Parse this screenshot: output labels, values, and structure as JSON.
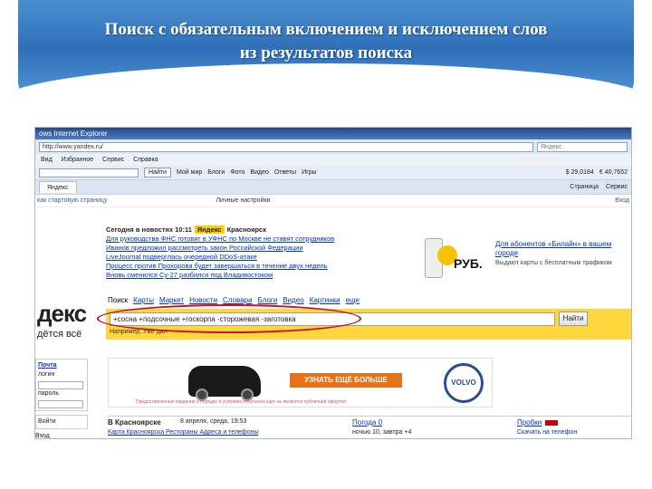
{
  "slide": {
    "title_line1": "Поиск с обязательным включением и исключением слов",
    "title_line2": "из результатов поиска"
  },
  "browser": {
    "title": "ows Internet Explorer",
    "address": "http://www.yandex.ru/",
    "search_placeholder": "Яндекс",
    "menu": [
      "Вид",
      "Избранное",
      "Сервис",
      "Справка"
    ],
    "toolbar": [
      "Найти",
      "Мой мир",
      "Блоги",
      "Фото",
      "Видео",
      "Ответы",
      "Игры"
    ],
    "toolbar_right": [
      "$ 29,0184",
      "€ 40,7652"
    ],
    "tab_label": "Яндекс",
    "tab_right": [
      "Страница",
      "Сервис"
    ]
  },
  "page": {
    "top_left": "как стартовую страницу",
    "top_mid": "Личные настройки",
    "top_right": "Вход",
    "news_header": "Сегодня в новостях 10:11",
    "news_badge": "Яндекс",
    "news_city": "Красноярск",
    "news": [
      "Для руководства ФНС готовят в УФНС по Москве не ставят сотрудников",
      "Иванов предложил рассмотреть закон Российской Федерации",
      "LiveJournal подверглась очередной DDoS-атаке",
      "Процесс против Прохорова будет завершаться в течение двух недель",
      "Вновь сменился Су-27 разбился под Владивостоком"
    ],
    "promo_link": "Для абонентов «Билайн» в вашем городе",
    "promo_text": "Выдают карты с бесплатным трафиком",
    "promo_rub": "РУБ.",
    "logo": "декс",
    "logo_sub": "дётся всё",
    "search_tabs": [
      "Поиск",
      "Карты",
      "Маркет",
      "Новости",
      "Словари",
      "Блоги",
      "Видео",
      "Картинки",
      "еще"
    ],
    "query": "+сосна +подсочные +госкорпа -сторожевая -заготовка",
    "find_button": "Найти",
    "example": "Например, Уже дал",
    "left": [
      "Почта",
      "логин",
      "пароль",
      "Войти",
      "Вход"
    ],
    "ad_button": "УЗНАТЬ ЕЩЁ БОЛЬШЕ",
    "ad_brand": "VOLVO",
    "ad_note": "Предоставленные сведения о порядке и условиях получения карт не являются публичной офертой",
    "city": "В Красноярске",
    "date": "8 апреля, среда, 19:53",
    "city_links": "Карта Красноярска  Рестораны  Адреса и телефоны",
    "weather": "Погода",
    "weather_value": "0",
    "weather_sub": "ночью 10, завтра +4",
    "traffic": "Пробки",
    "traffic_sub": "Скачать на телефон"
  }
}
